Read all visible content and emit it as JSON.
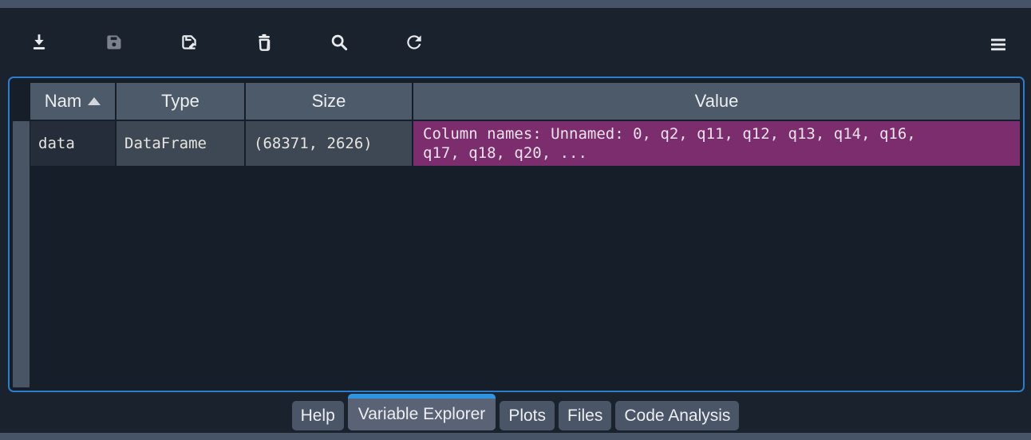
{
  "window": {
    "pane_title": "Variable Explorer"
  },
  "toolbar": {
    "buttons": [
      {
        "id": "import-data",
        "icon": "download-icon",
        "enabled": true
      },
      {
        "id": "save-data",
        "icon": "save-icon",
        "enabled": false
      },
      {
        "id": "save-data-as",
        "icon": "save-as-icon",
        "enabled": true
      },
      {
        "id": "remove-variable",
        "icon": "trash-icon",
        "enabled": true
      },
      {
        "id": "search",
        "icon": "search-icon",
        "enabled": true
      },
      {
        "id": "refresh",
        "icon": "refresh-icon",
        "enabled": true
      },
      {
        "id": "options-menu",
        "icon": "hamburger-icon",
        "enabled": true
      }
    ]
  },
  "table": {
    "columns": [
      {
        "label": "Nam",
        "sorted": "ascending"
      },
      {
        "label": "Type"
      },
      {
        "label": "Size"
      },
      {
        "label": "Value"
      }
    ],
    "rows": [
      {
        "name": "data",
        "type": "DataFrame",
        "size": "(68371, 2626)",
        "value": "Column names: Unnamed: 0, q2, q11, q12, q13, q14, q16, q17, q18, q20, ..."
      }
    ]
  },
  "tabs": [
    {
      "label": "Help",
      "active": false
    },
    {
      "label": "Variable Explorer",
      "active": true
    },
    {
      "label": "Plots",
      "active": false
    },
    {
      "label": "Files",
      "active": false
    },
    {
      "label": "Code Analysis",
      "active": false
    }
  ],
  "colors": {
    "panel_border": "#2e7dcc",
    "active_tab_accent": "#3095e0",
    "dataframe_value_bg": "#7b2d6e",
    "header_bg": "#4d5a69",
    "cell_bg": "#3e4854",
    "name_cell_bg": "#242d39",
    "window_chrome": "#475366",
    "background": "#1a222e"
  }
}
